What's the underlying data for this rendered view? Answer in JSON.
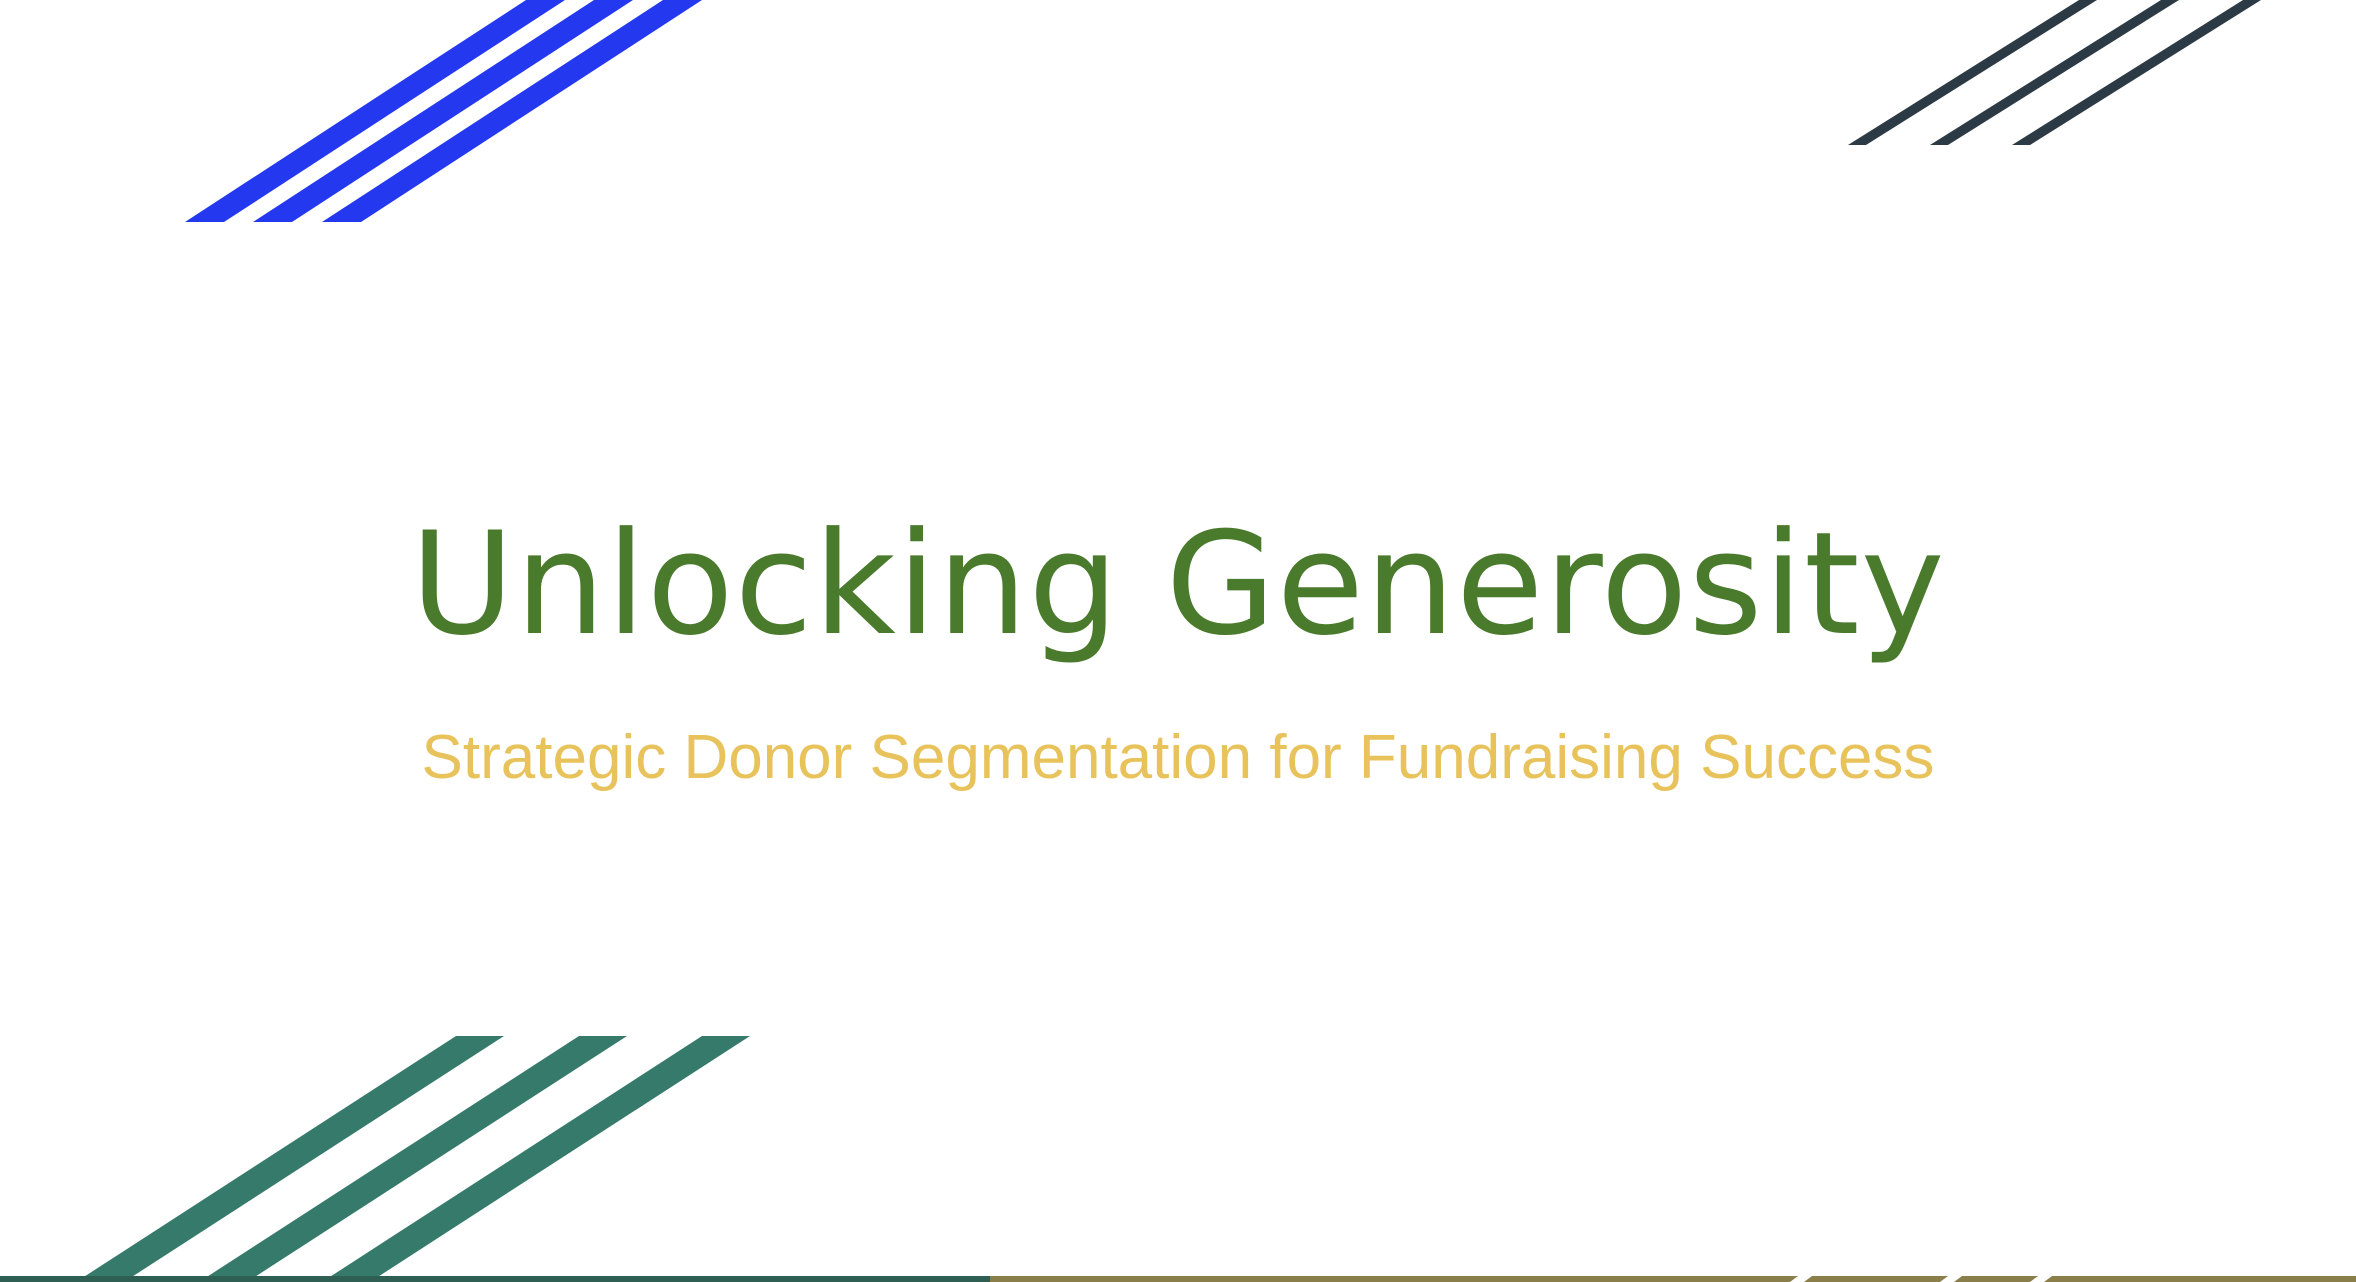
{
  "slide": {
    "title": "Unlocking Generosity",
    "subtitle": "Strategic Donor Segmentation for Fundraising Success"
  },
  "colors": {
    "background": "#ffffff",
    "title": "#4a7a2c",
    "subtitle": "#e8c25a",
    "stripes_top_left": "#2438f0",
    "stripes_top_right": "#2b3a44",
    "stripes_bottom_left": "#357a6a",
    "bottom_bar_left": "#2f5f52",
    "bottom_bar_right": "#8a7f4a"
  }
}
